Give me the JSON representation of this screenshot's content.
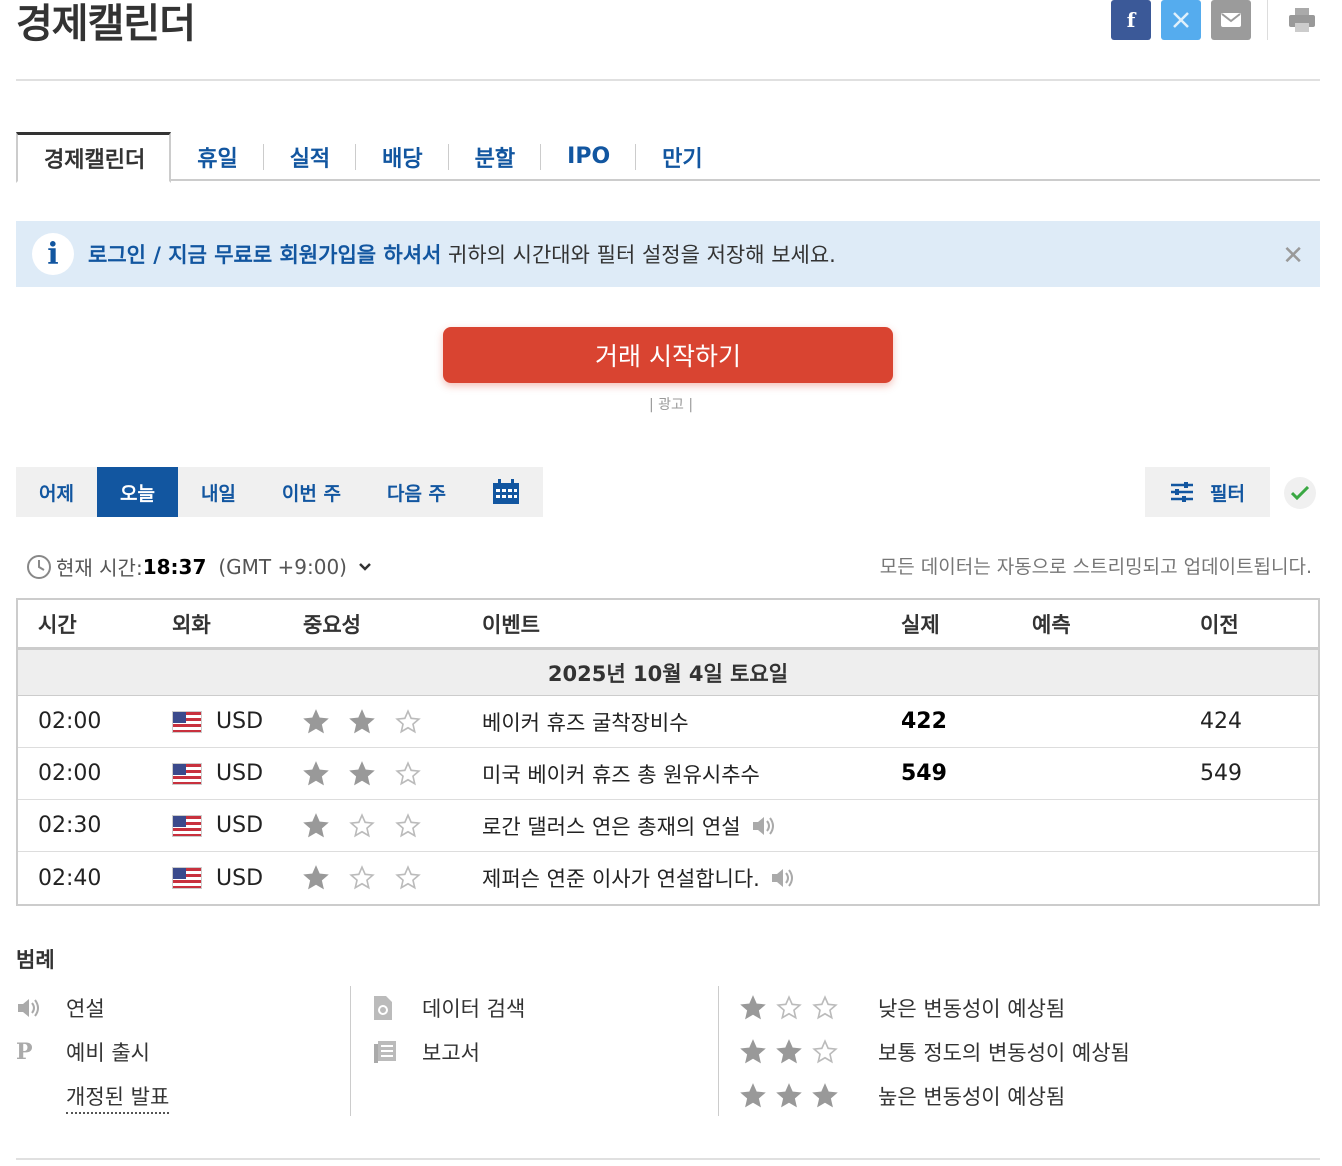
{
  "page": {
    "title": "경제캘린더"
  },
  "tabs": [
    {
      "label": "경제캘린더",
      "active": true
    },
    {
      "label": "휴일"
    },
    {
      "label": "실적"
    },
    {
      "label": "배당"
    },
    {
      "label": "분할"
    },
    {
      "label": "IPO"
    },
    {
      "label": "만기"
    }
  ],
  "notice": {
    "link_login": "로그인",
    "slash": " / ",
    "link_signup": "지금 무료로 회원가입을 하셔서",
    "text": " 귀하의 시간대와 필터 설정을 저장해 보세요."
  },
  "cta": {
    "label": "거래 시작하기",
    "ad_label": "| 광고 |"
  },
  "days": [
    {
      "label": "어제"
    },
    {
      "label": "오늘",
      "active": true
    },
    {
      "label": "내일"
    },
    {
      "label": "이번 주"
    },
    {
      "label": "다음 주"
    }
  ],
  "filter": {
    "label": "필터"
  },
  "time": {
    "label": "현재 시간:",
    "value": "18:37",
    "zone": "(GMT +9:00)",
    "stream_note": "모든 데이터는 자동으로 스트리밍되고 업데이트됩니다."
  },
  "table": {
    "headers": {
      "time": "시간",
      "currency": "외화",
      "importance": "중요성",
      "event": "이벤트",
      "actual": "실제",
      "forecast": "예측",
      "previous": "이전"
    },
    "date": "2025년 10월 4일 토요일",
    "rows": [
      {
        "time": "02:00",
        "currency": "USD",
        "stars": 2,
        "event": "베이커 휴즈 굴착장비수",
        "speech": false,
        "actual": "422",
        "forecast": "",
        "previous": "424"
      },
      {
        "time": "02:00",
        "currency": "USD",
        "stars": 2,
        "event": "미국 베이커 휴즈 총 원유시추수",
        "speech": false,
        "actual": "549",
        "forecast": "",
        "previous": "549"
      },
      {
        "time": "02:30",
        "currency": "USD",
        "stars": 1,
        "event": "로간 댈러스 연은 총재의 연설",
        "speech": true,
        "actual": "",
        "forecast": "",
        "previous": ""
      },
      {
        "time": "02:40",
        "currency": "USD",
        "stars": 1,
        "event": "제퍼슨 연준 이사가 연설합니다.",
        "speech": true,
        "actual": "",
        "forecast": "",
        "previous": ""
      }
    ]
  },
  "legend": {
    "title": "범례",
    "speech": "연설",
    "preliminary": "예비 출시",
    "revised": "개정된 발표",
    "data_search": "데이터 검색",
    "report": "보고서",
    "low": "낮은 변동성이 예상됨",
    "medium": "보통 정도의 변동성이 예상됨",
    "high": "높은 변동성이 예상됨"
  },
  "colors": {
    "link": "#1256a0",
    "cta": "#d94431",
    "notice_bg": "#deebf7"
  }
}
